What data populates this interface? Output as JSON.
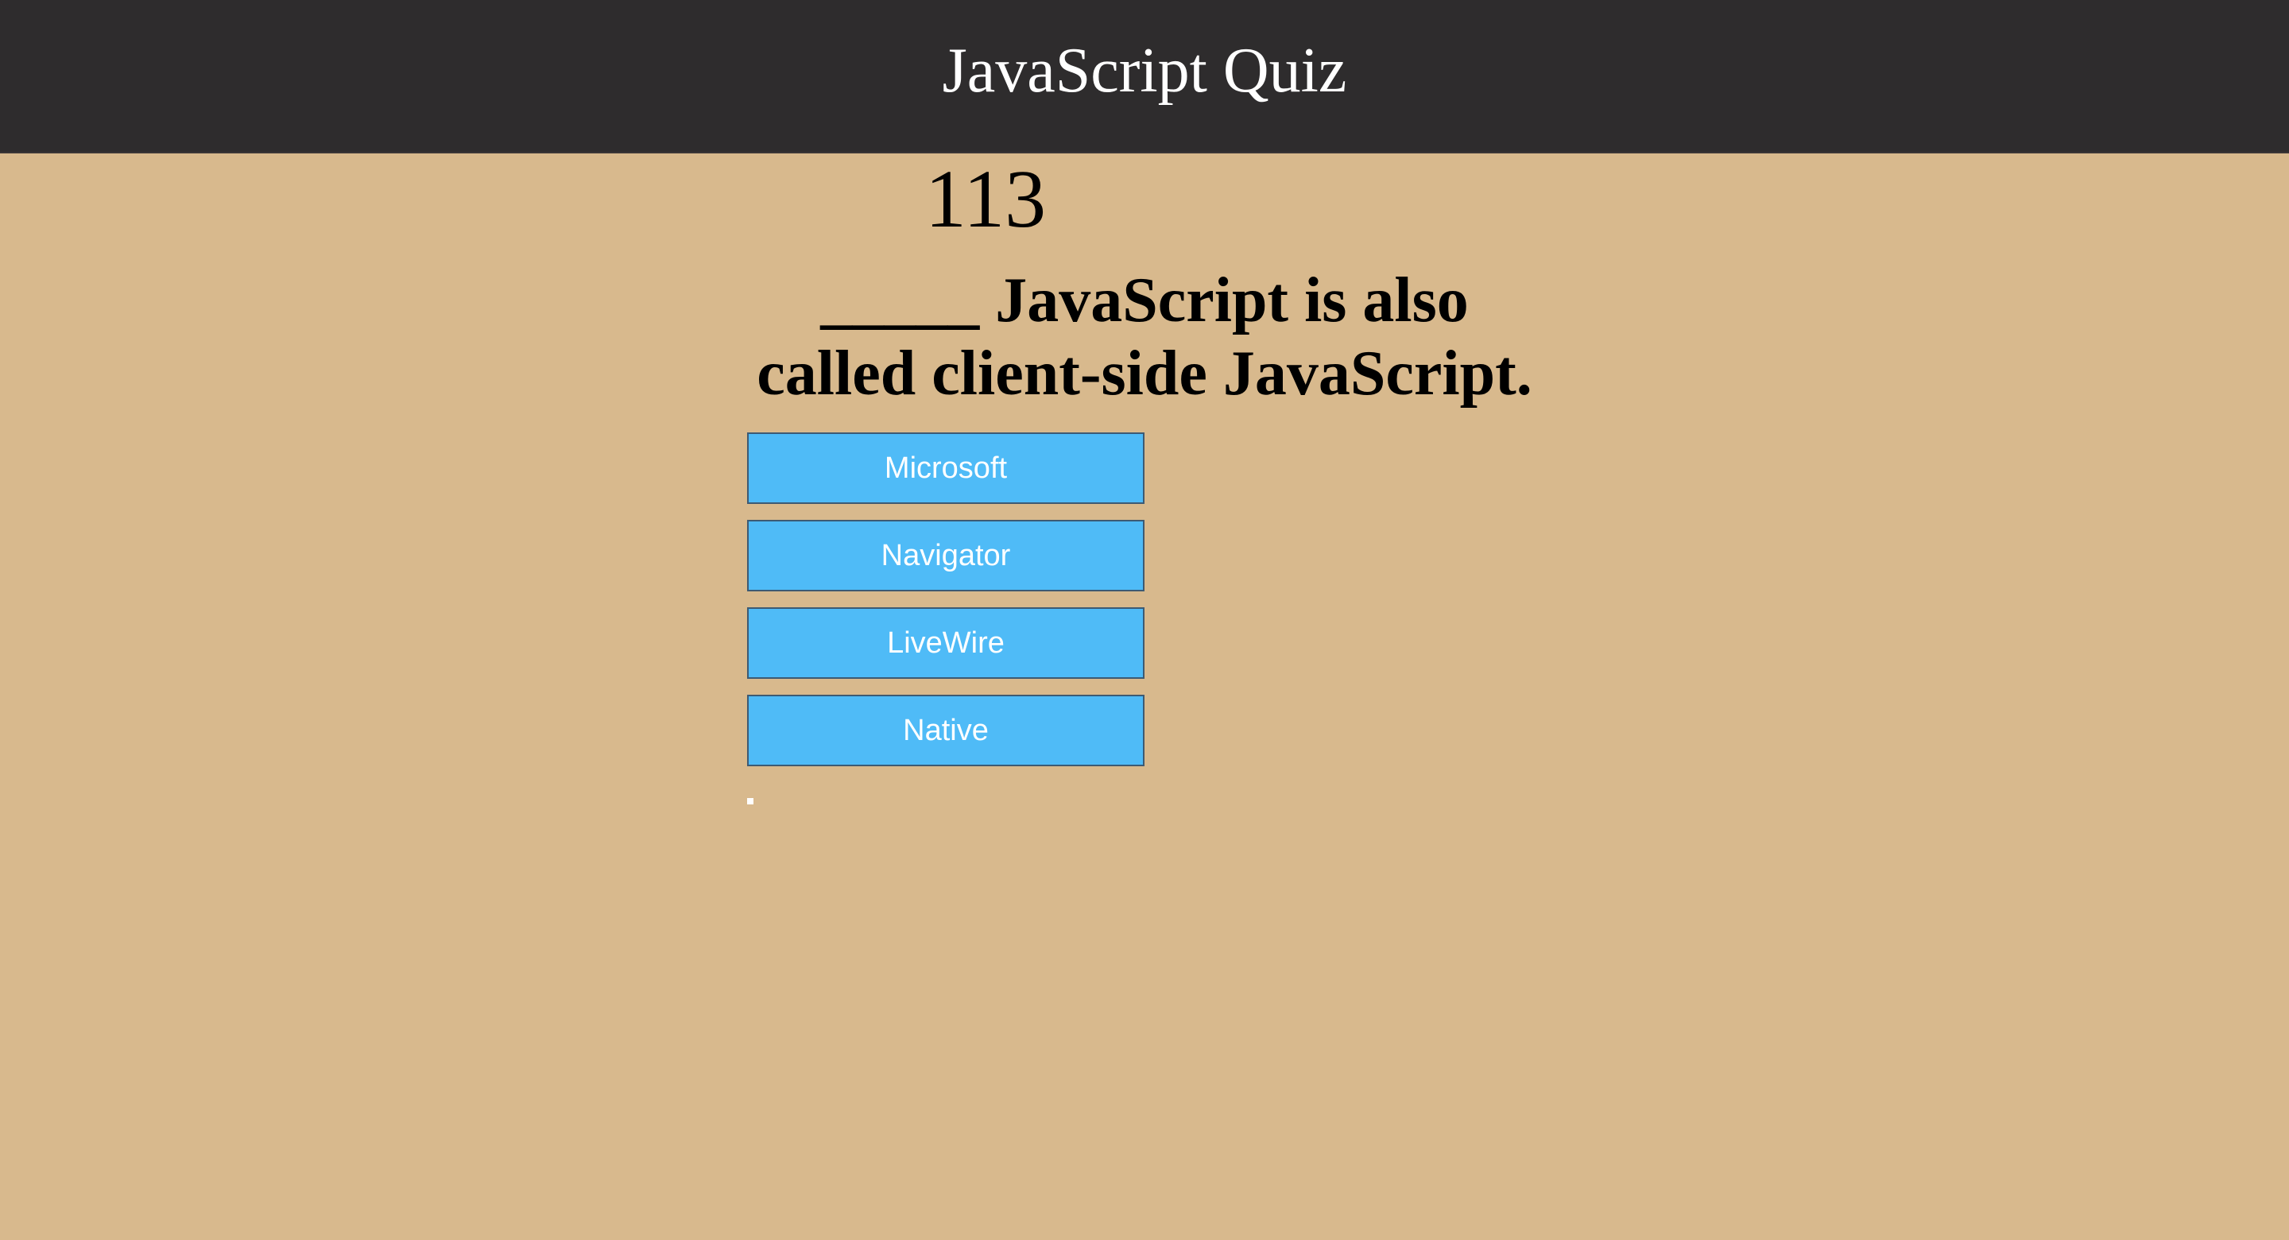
{
  "header": {
    "title": "JavaScript Quiz"
  },
  "quiz": {
    "timer": "113",
    "question": "_____ JavaScript is also called client-side JavaScript.",
    "choices": [
      "Microsoft",
      "Navigator",
      "LiveWire",
      "Native"
    ]
  },
  "colors": {
    "header_background": "#2e2c2d",
    "page_background": "#d8b98d",
    "button_background": "#4fbbf7",
    "button_border": "#3d5a73",
    "button_text": "#ffffff"
  }
}
